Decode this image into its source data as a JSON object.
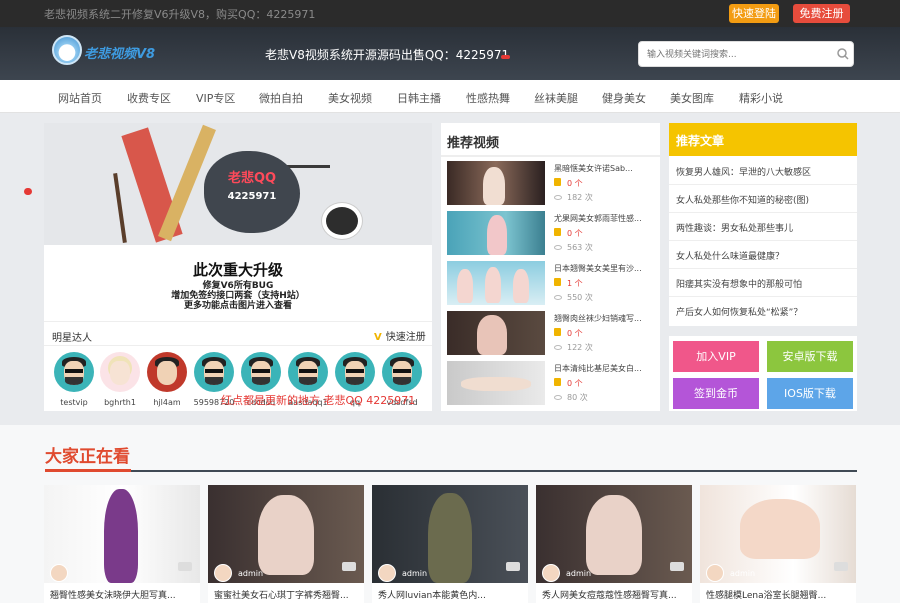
{
  "topbar": {
    "notice": "老悲视频系统二开修复V6升级V8，购买QQ：4225971",
    "login_label": "快速登陆",
    "register_label": "免费注册"
  },
  "header": {
    "logo_text": "老悲视频V8",
    "slogan": "老悲V8视频系统开源源码出售QQ：4225971",
    "search_placeholder": "输入视频关键词搜索..."
  },
  "nav": {
    "items": [
      "网站首页",
      "收费专区",
      "VIP专区",
      "微拍自拍",
      "美女视频",
      "日韩主播",
      "性感热舞",
      "丝袜美腿",
      "健身美女",
      "美女图库",
      "精彩小说"
    ]
  },
  "banner": {
    "qq_title": "老悲QQ",
    "qq_number": "4225971",
    "title": "此次重大升级",
    "line1": "修复V6所有BUG",
    "line2": "增加免签约接口两套（支持H站）",
    "line3": "更多功能点击图片进入查看"
  },
  "stars": {
    "title": "明星达人",
    "quick_register": "快速注册",
    "users": [
      "testvip",
      "bghrth1",
      "hjl4am",
      "59598720",
      "cdcdcd",
      "aasdaqq1",
      "qq",
      "vdsdfsd"
    ],
    "overlay": "红点都是更新的地方   老悲QQ 4225971"
  },
  "recommend": {
    "title": "推荐视频",
    "items": [
      {
        "title": "黑暗惬美女许诺Sab...",
        "count": "0 个",
        "views": "182 次"
      },
      {
        "title": "尤果网美女郭雨菲性感...",
        "count": "0 个",
        "views": "563 次"
      },
      {
        "title": "日本翘臀美女美里有沙...",
        "count": "1 个",
        "views": "550 次"
      },
      {
        "title": "翘臀肉丝袜少妇销魂写...",
        "count": "0 个",
        "views": "122 次"
      },
      {
        "title": "日本清纯比基尼美女白...",
        "count": "0 个",
        "views": "80 次"
      }
    ]
  },
  "articles": {
    "title": "推荐文章",
    "items": [
      "恢复男人雄风：早泄的八大敏感区",
      "女人私处那些你不知道的秘密(图)",
      "两性趣谈：男女私处那些事儿",
      "女人私处什么味道最健康？",
      "阳痿其实没有想象中的那般可怕",
      "产后女人如何恢复私处“松紧”？"
    ]
  },
  "actions": {
    "join_vip": "加入VIP",
    "android": "安卓版下载",
    "signin": "签到金币",
    "ios": "IOS版下载"
  },
  "watching": {
    "title": "大家正在看",
    "cards": [
      {
        "user": "",
        "title": "翘臀性感美女沫晓伊大胆写真..."
      },
      {
        "user": "admin",
        "title": "蜜蜜社美女石心琪丁字裤秀翘臀..."
      },
      {
        "user": "admin",
        "title": "秀人网luvian本能黄色内..."
      },
      {
        "user": "admin",
        "title": "秀人网美女痘蔻蔻性感翘臀写真..."
      },
      {
        "user": "admin",
        "title": "性感腿模Lena浴室长腿翘臀..."
      }
    ]
  },
  "colors": {
    "accent_orange": "#f39c12",
    "accent_red": "#e74c3c",
    "yellow": "#f5c400",
    "section_red": "#e04a2f"
  }
}
